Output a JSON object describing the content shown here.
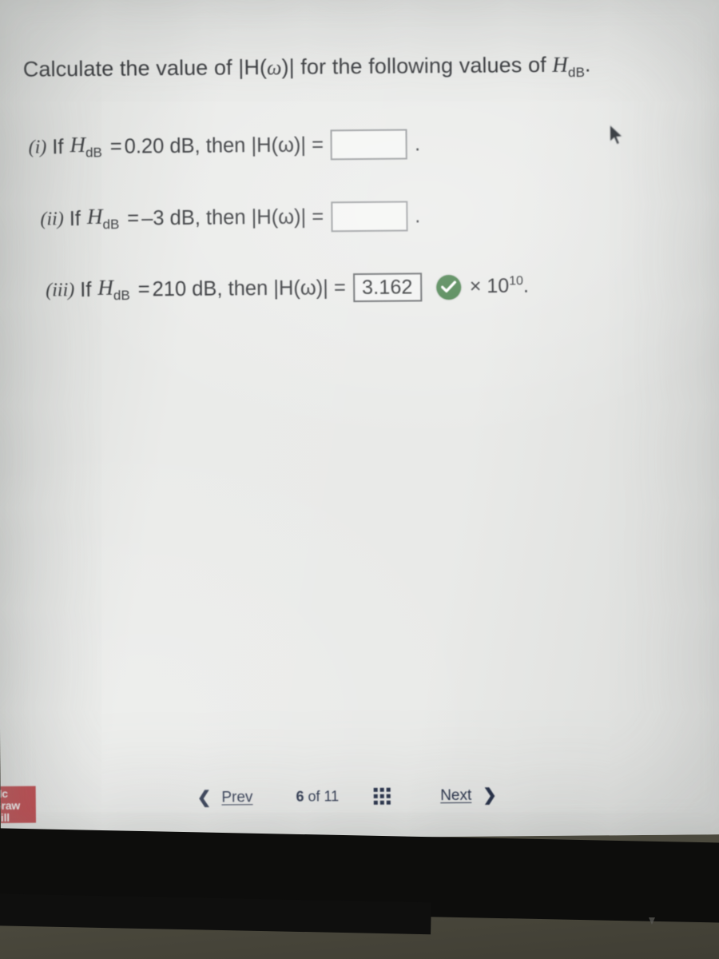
{
  "question": {
    "heading_pre": "Calculate the value of |H(",
    "heading_omega": "ω",
    "heading_mid": ")| for the following values of ",
    "heading_var": "H",
    "heading_var_sub": "dB",
    "heading_end": "."
  },
  "parts": [
    {
      "numeral": "(i)",
      "if_label": "If",
      "variable": "H",
      "subscript": "dB",
      "equals": "=",
      "value": "0.20 dB, then |H(ω)| =",
      "answer": "",
      "answer_placeholder": "",
      "filled": false,
      "correct": false,
      "suffix": "",
      "trailing": "."
    },
    {
      "numeral": "(ii)",
      "if_label": "If",
      "variable": "H",
      "subscript": "dB",
      "equals": "=",
      "value": "–3 dB, then |H(ω)| =",
      "answer": "",
      "answer_placeholder": "",
      "filled": false,
      "correct": false,
      "suffix": "",
      "trailing": "."
    },
    {
      "numeral": "(iii)",
      "if_label": "If",
      "variable": "H",
      "subscript": "dB",
      "equals": "=",
      "value": "210 dB, then |H(ω)| =",
      "answer": "3.162",
      "answer_placeholder": "",
      "filled": true,
      "correct": true,
      "suffix_multiplier": "× 10",
      "suffix_exponent": "10",
      "trailing": "."
    }
  ],
  "feedback": {
    "status": "correct",
    "icon": "check-circle-icon",
    "color": "#3f7a43"
  },
  "branding": {
    "logo_line1": "Mc",
    "logo_line2": "Graw",
    "logo_line3": "Hill",
    "logo_color": "#b8252b"
  },
  "navigation": {
    "prev_icon": "chevron-left-icon",
    "prev_label": "Prev",
    "current_page": "6",
    "of_label": "of",
    "total_pages": "11",
    "grid_icon": "grid-3x3-icon",
    "next_label": "Next",
    "next_icon": "chevron-right-icon"
  },
  "pointer": {
    "icon": "mouse-cursor-icon",
    "x": "775",
    "y": "185"
  }
}
